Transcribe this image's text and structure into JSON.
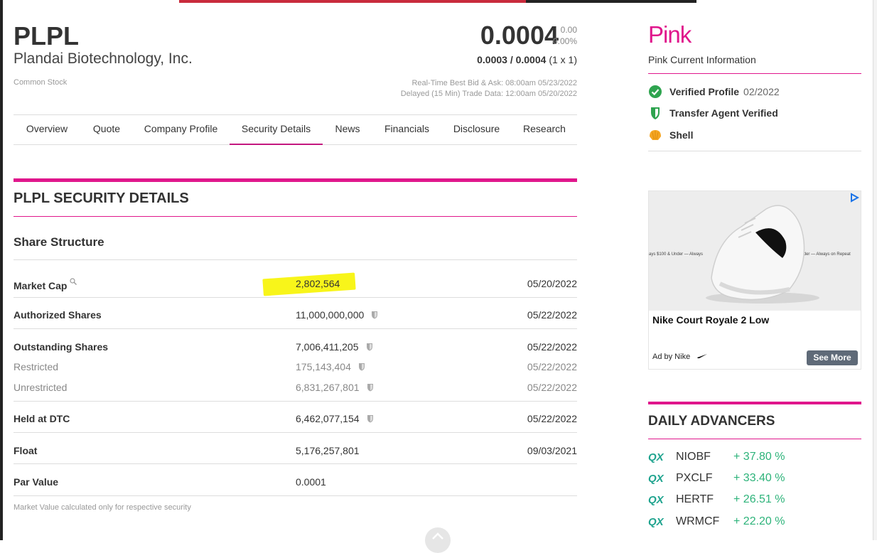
{
  "header": {
    "symbol": "PLPL",
    "company": "Plandai Biotechnology, Inc.",
    "security_type": "Common Stock",
    "price": "0.0004",
    "change": "0.00",
    "change_pct": "0.00%",
    "bid_ask": "0.0003 / 0.0004",
    "bid_ask_size": "(1 x 1)",
    "realtime_label": "Real-Time Best Bid & Ask: 08:00am 05/23/2022",
    "delayed_label": "Delayed (15 Min) Trade Data: 12:00am 05/20/2022"
  },
  "tabs": [
    {
      "label": "Overview"
    },
    {
      "label": "Quote"
    },
    {
      "label": "Company Profile"
    },
    {
      "label": "Security Details",
      "active": true
    },
    {
      "label": "News"
    },
    {
      "label": "Financials"
    },
    {
      "label": "Disclosure"
    },
    {
      "label": "Research"
    }
  ],
  "section": {
    "title": "PLPL SECURITY DETAILS",
    "subtitle": "Share Structure"
  },
  "rows": [
    {
      "label": "Market Cap",
      "value": "2,802,564",
      "date": "05/20/2022"
    },
    {
      "label": "Authorized Shares",
      "value": "11,000,000,000",
      "date": "05/22/2022"
    },
    {
      "label": "Outstanding Shares",
      "value": "7,006,411,205",
      "date": "05/22/2022"
    },
    {
      "label": "Restricted",
      "value": "175,143,404",
      "date": "05/22/2022"
    },
    {
      "label": "Unrestricted",
      "value": "6,831,267,801",
      "date": "05/22/2022"
    },
    {
      "label": "Held at DTC",
      "value": "6,462,077,154",
      "date": "05/22/2022"
    },
    {
      "label": "Float",
      "value": "5,176,257,801",
      "date": "09/03/2021"
    },
    {
      "label": "Par Value",
      "value": "0.0001",
      "date": ""
    }
  ],
  "footnote": "Market Value calculated only for respective security",
  "sidebar": {
    "tier_logo": "Pink",
    "tier_info": "Pink Current Information",
    "badges": [
      {
        "label": "Verified Profile",
        "date": "02/2022",
        "icon": "check-circle-icon",
        "color": "#2ea44f"
      },
      {
        "label": "Transfer Agent Verified",
        "date": "",
        "icon": "shield-icon",
        "color": "#2ea44f"
      },
      {
        "label": "Shell",
        "date": "",
        "icon": "shell-icon",
        "color": "#f5a623"
      }
    ]
  },
  "ad": {
    "strip_left": "ays $100 & Under  —  Always",
    "strip_right": "$0 & Under  —  Always on Repeat",
    "title": "Nike Court Royale 2 Low",
    "by": "Ad by Nike",
    "cta": "See More"
  },
  "advancers": {
    "title": "DAILY ADVANCERS",
    "tier": "QX",
    "items": [
      {
        "symbol": "NIOBF",
        "pct": "+ 37.80 %"
      },
      {
        "symbol": "PXCLF",
        "pct": "+ 33.40 %"
      },
      {
        "symbol": "HERTF",
        "pct": "+ 26.51 %"
      },
      {
        "symbol": "WRMCF",
        "pct": "+ 22.20 %"
      }
    ]
  },
  "colors": {
    "accent_pink": "#e0168c",
    "qx_green": "#1ea38e",
    "gain_green": "#2db37a"
  }
}
